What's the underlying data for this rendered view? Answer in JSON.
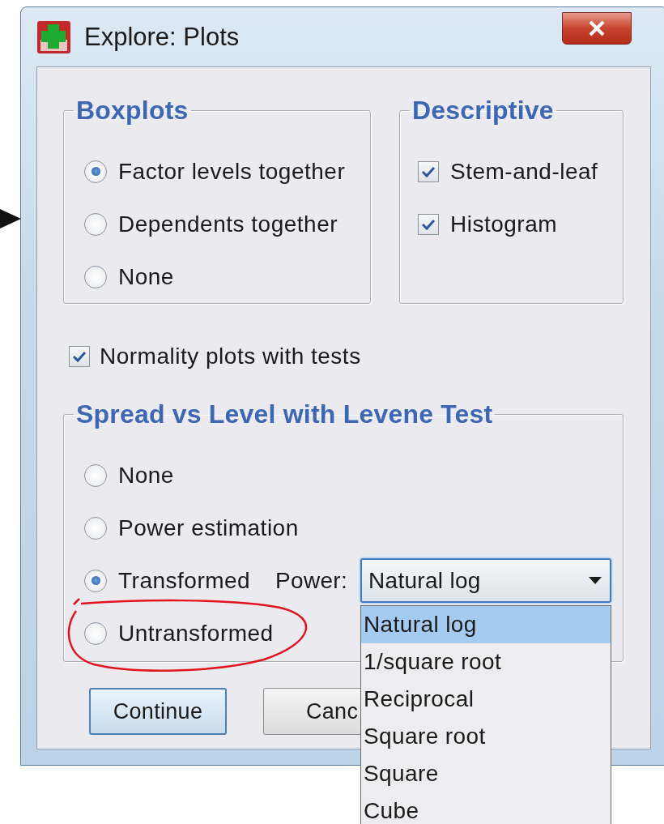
{
  "window": {
    "title": "Explore: Plots"
  },
  "boxplots": {
    "title": "Boxplots",
    "options": [
      {
        "label": "Factor levels together",
        "selected": true
      },
      {
        "label": "Dependents together",
        "selected": false
      },
      {
        "label": "None",
        "selected": false
      }
    ]
  },
  "descriptive": {
    "title": "Descriptive",
    "options": [
      {
        "label": "Stem-and-leaf",
        "checked": true
      },
      {
        "label": "Histogram",
        "checked": true
      }
    ]
  },
  "normality": {
    "label": "Normality plots with tests",
    "checked": true
  },
  "spread_vs_level": {
    "title": "Spread vs Level with Levene Test",
    "options": [
      {
        "label": "None",
        "selected": false
      },
      {
        "label": "Power estimation",
        "selected": false
      },
      {
        "label": "Transformed",
        "selected": true,
        "power": {
          "label": "Power:",
          "value": "Natural log",
          "expanded": true,
          "options": [
            {
              "label": "Natural log",
              "selected": true
            },
            {
              "label": "1/square root",
              "selected": false
            },
            {
              "label": "Reciprocal",
              "selected": false
            },
            {
              "label": "Square root",
              "selected": false
            },
            {
              "label": "Square",
              "selected": false
            },
            {
              "label": "Cube",
              "selected": false
            }
          ]
        }
      },
      {
        "label": "Untransformed",
        "selected": false
      }
    ]
  },
  "buttons": [
    {
      "label": "Continue",
      "default": true
    },
    {
      "label": "Canc",
      "default": false
    }
  ]
}
